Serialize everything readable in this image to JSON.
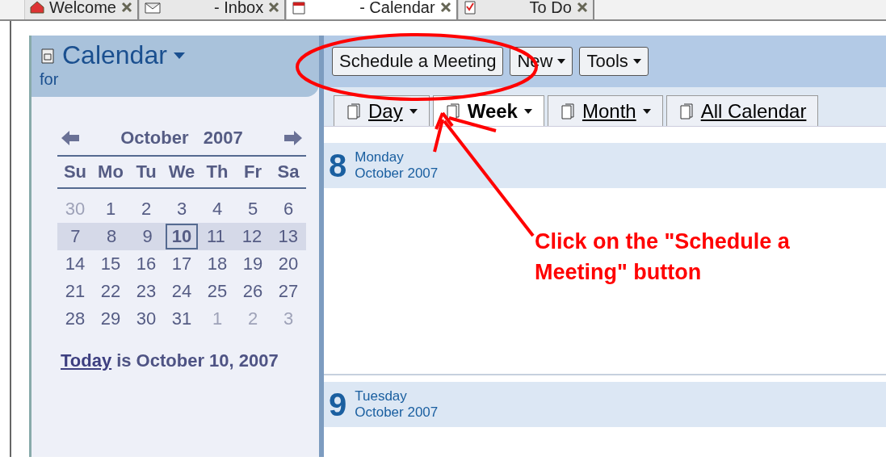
{
  "app_tabs": [
    {
      "label": "Welcome",
      "kind": "home",
      "selected": false
    },
    {
      "label": "- Inbox",
      "kind": "mail",
      "selected": false
    },
    {
      "label": "- Calendar",
      "kind": "calendar",
      "selected": true
    },
    {
      "label": "To Do",
      "kind": "todo",
      "selected": false
    }
  ],
  "sidebar": {
    "title": "Calendar",
    "owner_prefix": "for",
    "mini_calendar": {
      "month": "October",
      "year": "2007",
      "weekdays": [
        "Su",
        "Mo",
        "Tu",
        "We",
        "Th",
        "Fr",
        "Sa"
      ],
      "weeks": [
        {
          "highlighted": false,
          "days": [
            {
              "label": "30",
              "muted": true,
              "selected": false
            },
            {
              "label": "1",
              "muted": false,
              "selected": false
            },
            {
              "label": "2",
              "muted": false,
              "selected": false
            },
            {
              "label": "3",
              "muted": false,
              "selected": false
            },
            {
              "label": "4",
              "muted": false,
              "selected": false
            },
            {
              "label": "5",
              "muted": false,
              "selected": false
            },
            {
              "label": "6",
              "muted": false,
              "selected": false
            }
          ]
        },
        {
          "highlighted": true,
          "days": [
            {
              "label": "7",
              "muted": false,
              "selected": false
            },
            {
              "label": "8",
              "muted": false,
              "selected": false
            },
            {
              "label": "9",
              "muted": false,
              "selected": false
            },
            {
              "label": "10",
              "muted": false,
              "selected": true
            },
            {
              "label": "11",
              "muted": false,
              "selected": false
            },
            {
              "label": "12",
              "muted": false,
              "selected": false
            },
            {
              "label": "13",
              "muted": false,
              "selected": false
            }
          ]
        },
        {
          "highlighted": false,
          "days": [
            {
              "label": "14",
              "muted": false,
              "selected": false
            },
            {
              "label": "15",
              "muted": false,
              "selected": false
            },
            {
              "label": "16",
              "muted": false,
              "selected": false
            },
            {
              "label": "17",
              "muted": false,
              "selected": false
            },
            {
              "label": "18",
              "muted": false,
              "selected": false
            },
            {
              "label": "19",
              "muted": false,
              "selected": false
            },
            {
              "label": "20",
              "muted": false,
              "selected": false
            }
          ]
        },
        {
          "highlighted": false,
          "days": [
            {
              "label": "21",
              "muted": false,
              "selected": false
            },
            {
              "label": "22",
              "muted": false,
              "selected": false
            },
            {
              "label": "23",
              "muted": false,
              "selected": false
            },
            {
              "label": "24",
              "muted": false,
              "selected": false
            },
            {
              "label": "25",
              "muted": false,
              "selected": false
            },
            {
              "label": "26",
              "muted": false,
              "selected": false
            },
            {
              "label": "27",
              "muted": false,
              "selected": false
            }
          ]
        },
        {
          "highlighted": false,
          "days": [
            {
              "label": "28",
              "muted": false,
              "selected": false
            },
            {
              "label": "29",
              "muted": false,
              "selected": false
            },
            {
              "label": "30",
              "muted": false,
              "selected": false
            },
            {
              "label": "31",
              "muted": false,
              "selected": false
            },
            {
              "label": "1",
              "muted": true,
              "selected": false
            },
            {
              "label": "2",
              "muted": true,
              "selected": false
            },
            {
              "label": "3",
              "muted": true,
              "selected": false
            }
          ]
        }
      ]
    },
    "today_link": "Today",
    "today_text": "is October 10, 2007"
  },
  "toolbar": [
    {
      "label": "Schedule a Meeting",
      "dropdown": false
    },
    {
      "label": "New",
      "dropdown": true
    },
    {
      "label": "Tools",
      "dropdown": true
    }
  ],
  "view_tabs": [
    {
      "label": "Day",
      "selected": false
    },
    {
      "label": "Week",
      "selected": true
    },
    {
      "label": "Month",
      "selected": false
    },
    {
      "label": "All Calendar",
      "selected": false
    }
  ],
  "days": [
    {
      "number": "8",
      "weekday": "Monday",
      "month": "October 2007"
    },
    {
      "number": "9",
      "weekday": "Tuesday",
      "month": "October 2007"
    }
  ],
  "annotation": {
    "text": "Click on the \"Schedule a Meeting\" button"
  }
}
